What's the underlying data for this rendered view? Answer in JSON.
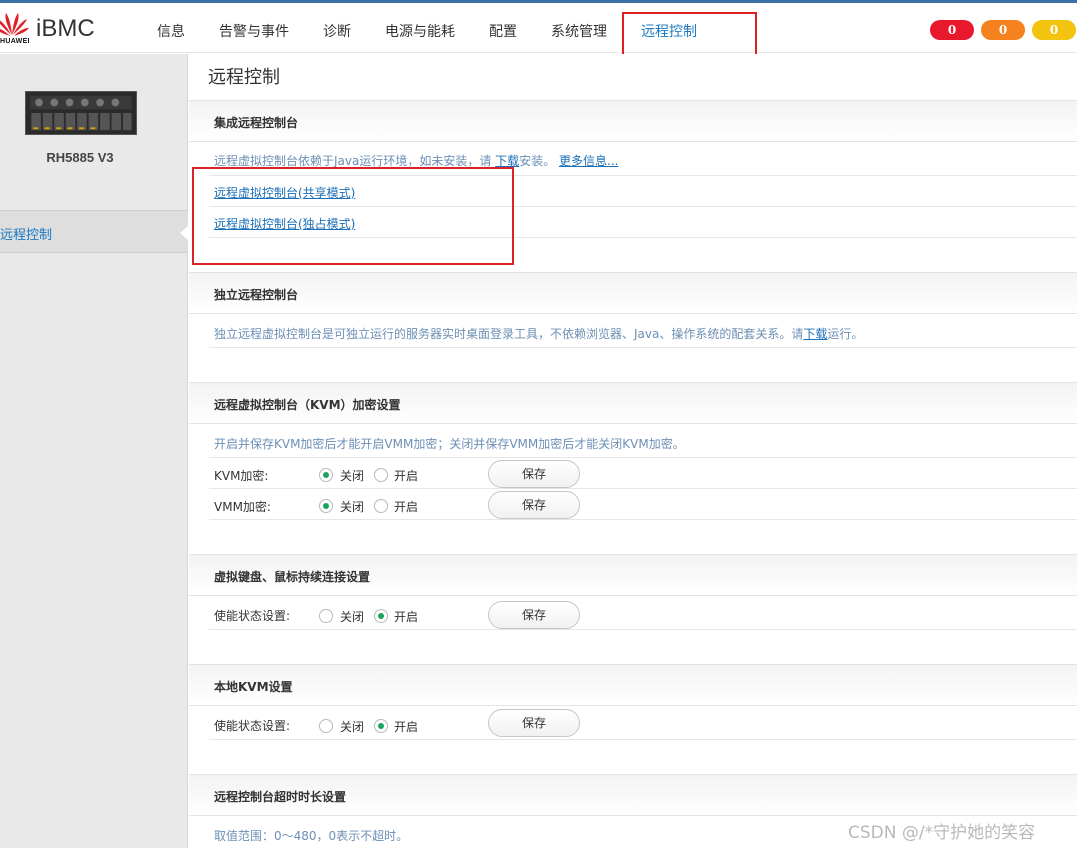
{
  "brand": {
    "name": "iBMC",
    "sub": "HUAWEI"
  },
  "nav": [
    "信息",
    "告警与事件",
    "诊断",
    "电源与能耗",
    "配置",
    "系统管理",
    "远程控制"
  ],
  "alerts": {
    "critical": "0",
    "major": "0",
    "minor": "0"
  },
  "sidebar": {
    "server_name": "RH5885 V3",
    "item": "远程控制"
  },
  "page_title": "远程控制",
  "integrated": {
    "title": "集成远程控制台",
    "desc_pre": "远程虚拟控制台依赖于Java运行环境，如未安装，请 ",
    "download": "下载",
    "desc_post": "安装。 ",
    "more": "更多信息...",
    "link_shared": "远程虚拟控制台(共享模式)",
    "link_exclusive": "远程虚拟控制台(独占模式)"
  },
  "standalone": {
    "title": "独立远程控制台",
    "desc_pre": "独立远程虚拟控制台是可独立运行的服务器实时桌面登录工具，不依赖浏览器、Java、操作系统的配套关系。请",
    "download": "下载",
    "desc_post": "运行。"
  },
  "kvm_encrypt": {
    "title": "远程虚拟控制台（KVM）加密设置",
    "desc": "开启并保存KVM加密后才能开启VMM加密；关闭并保存VMM加密后才能关闭KVM加密。",
    "kvm_label": "KVM加密:",
    "vmm_label": "VMM加密:"
  },
  "persist": {
    "title": "虚拟键盘、鼠标持续连接设置",
    "label": "使能状态设置:"
  },
  "local_kvm": {
    "title": "本地KVM设置",
    "label": "使能状态设置:"
  },
  "timeout": {
    "title": "远程控制台超时时长设置",
    "desc": "取值范围：0～480，0表示不超时。"
  },
  "common": {
    "off": "关闭",
    "on": "开启",
    "save": "保存"
  },
  "watermark": "CSDN @/*守护她的笑容"
}
